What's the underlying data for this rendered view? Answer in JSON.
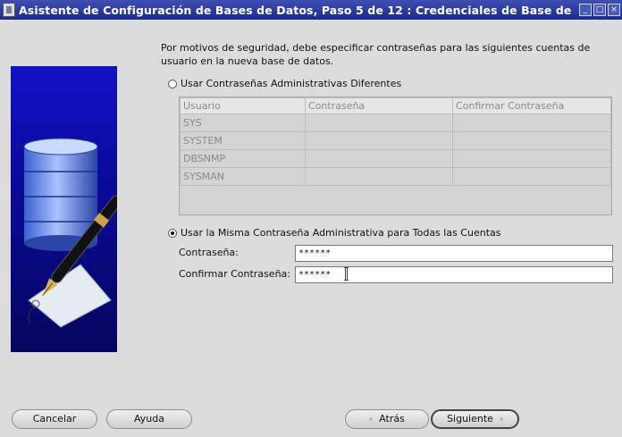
{
  "window": {
    "title": "Asistente de Configuración de Bases de Datos, Paso 5 de 12 : Credenciales de Base de",
    "controls": [
      "_",
      "□",
      "×"
    ]
  },
  "intro_text": "Por motivos de seguridad, debe especificar contraseñas para las siguientes cuentas de usuario en la nueva base de datos.",
  "option_different": {
    "label": "Usar Contraseñas Administrativas Diferentes",
    "selected": false
  },
  "table": {
    "headers": [
      "Usuario",
      "Contraseña",
      "Confirmar Contraseña"
    ],
    "rows": [
      [
        "SYS",
        "",
        ""
      ],
      [
        "SYSTEM",
        "",
        ""
      ],
      [
        "DBSNMP",
        "",
        ""
      ],
      [
        "SYSMAN",
        "",
        ""
      ]
    ]
  },
  "option_same": {
    "label": "Usar la Misma Contraseña Administrativa para Todas las Cuentas",
    "selected": true
  },
  "password": {
    "label": "Contraseña:",
    "value": "******"
  },
  "confirm_password": {
    "label": "Confirmar Contraseña:",
    "value": "******"
  },
  "buttons": {
    "cancel": "Cancelar",
    "help": "Ayuda",
    "back": "Atrás",
    "next": "Siguiente"
  },
  "icons": {
    "app": "app-icon",
    "art": "database-pen-illustration",
    "back": "chevron-left-icon",
    "next": "chevron-right-icon"
  },
  "colors": {
    "titlebar": "#1d2a8c",
    "art_background": "#0a0a9a",
    "window_background": "#dcdcdc"
  }
}
